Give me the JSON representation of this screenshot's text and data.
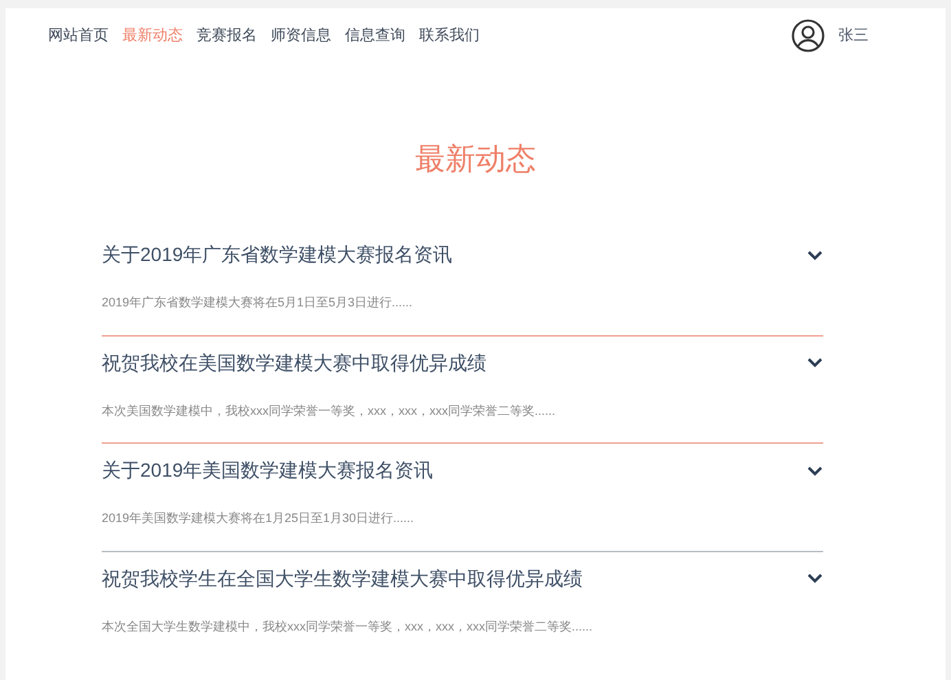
{
  "nav": [
    {
      "label": "网站首页",
      "selected": false
    },
    {
      "label": "最新动态",
      "selected": true
    },
    {
      "label": "竞赛报名",
      "selected": false
    },
    {
      "label": "师资信息",
      "selected": false
    },
    {
      "label": "信息查询",
      "selected": false
    },
    {
      "label": "联系我们",
      "selected": false
    }
  ],
  "user": {
    "name": "张三"
  },
  "heading": "最新动态",
  "news": [
    {
      "title": "关于2019年广东省数学建模大赛报名资讯",
      "summary": "2019年广东省数学建模大赛将在5月1日至5月3日进行......",
      "divider_highlighted": true
    },
    {
      "title": "祝贺我校在美国数学建模大赛中取得优异成绩",
      "summary": "本次美国数学建模中，我校xxx同学荣誉一等奖，xxx，xxx，xxx同学荣誉二等奖......",
      "divider_highlighted": true
    },
    {
      "title": "关于2019年美国数学建模大赛报名资讯",
      "summary": "2019年美国数学建模大赛将在1月25日至1月30日进行......",
      "divider_highlighted": false
    },
    {
      "title": "祝贺我校学生在全国大学生数学建模大赛中取得优异成绩",
      "summary": "本次全国大学生数学建模中，我校xxx同学荣誉一等奖，xxx，xxx，xxx同学荣誉二等奖......"
    }
  ]
}
